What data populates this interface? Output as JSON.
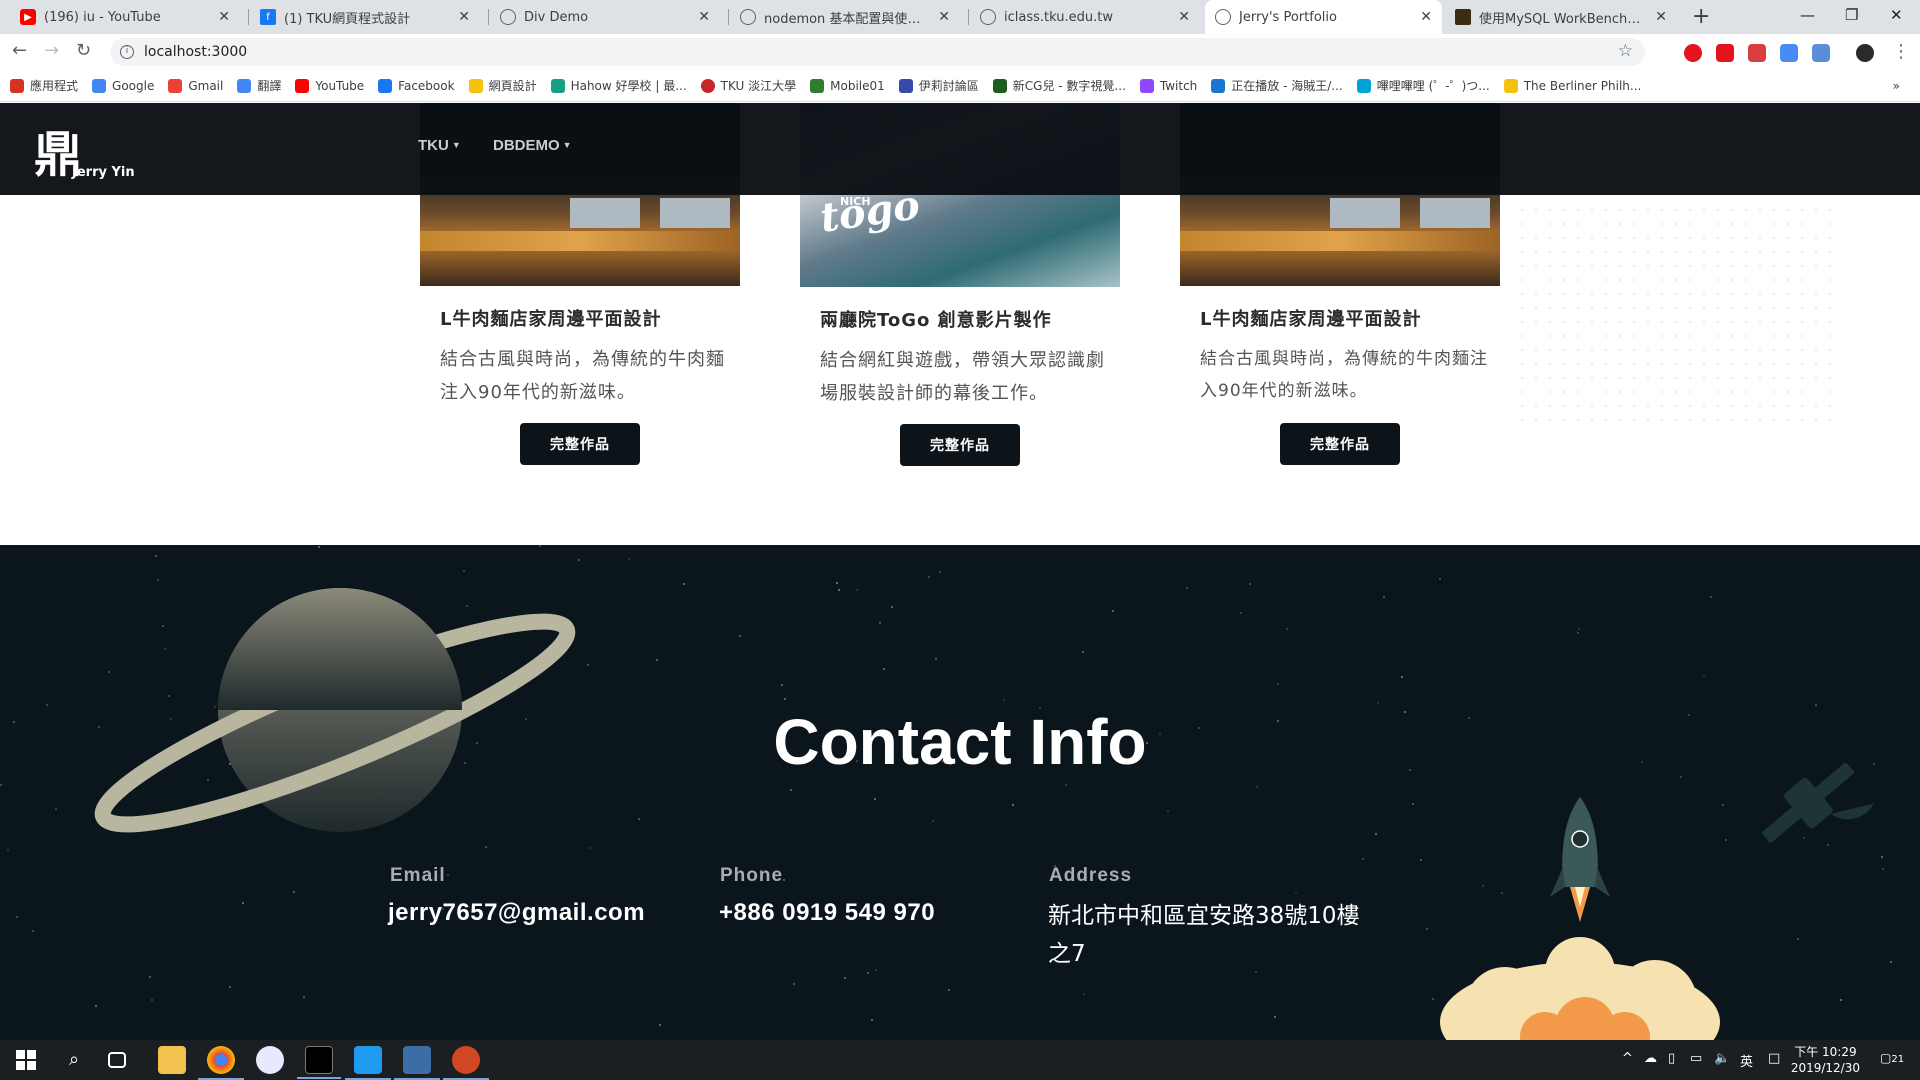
{
  "browser": {
    "tabs": [
      {
        "title": "(196) iu - YouTube",
        "favicon": "youtube-icon",
        "color": "#ff0000"
      },
      {
        "title": "(1) TKU網頁程式設計",
        "favicon": "facebook-icon",
        "color": "#1877f2"
      },
      {
        "title": "Div Demo",
        "favicon": "globe-icon",
        "color": "#5f6368"
      },
      {
        "title": "nodemon 基本配置與使用 - 壹言",
        "favicon": "globe-icon",
        "color": "#5f6368"
      },
      {
        "title": "iclass.tku.edu.tw",
        "favicon": "globe-icon",
        "color": "#5f6368"
      },
      {
        "title": "Jerry's Portfolio",
        "favicon": "globe-icon",
        "color": "#5f6368"
      },
      {
        "title": "使用MySQL WorkBench匯入資料",
        "favicon": "site-icon",
        "color": "#3b2d14"
      }
    ],
    "url": "localhost:3000",
    "bookmarks": [
      {
        "label": "應用程式",
        "color": "#d93025"
      },
      {
        "label": "Google",
        "color": "#4285f4"
      },
      {
        "label": "Gmail",
        "color": "#ea4335"
      },
      {
        "label": "翻譯",
        "color": "#4285f4"
      },
      {
        "label": "YouTube",
        "color": "#ff0000"
      },
      {
        "label": "Facebook",
        "color": "#1877f2"
      },
      {
        "label": "網頁設計",
        "color": "#f4c20d"
      },
      {
        "label": "Hahow 好學校 | 最...",
        "color": "#14a085"
      },
      {
        "label": "TKU 淡江大學",
        "color": "#c62828"
      },
      {
        "label": "Mobile01",
        "color": "#2e7d32"
      },
      {
        "label": "伊莉討論區",
        "color": "#3949ab"
      },
      {
        "label": "新CG兒 - 數字視覺...",
        "color": "#1b5e20"
      },
      {
        "label": "Twitch",
        "color": "#9146ff"
      },
      {
        "label": "正在播放 - 海賊王/...",
        "color": "#1976d2"
      },
      {
        "label": "嗶哩嗶哩 (゜-゜)つ...",
        "color": "#00a1d6"
      },
      {
        "label": "The Berliner Philh...",
        "color": "#f4c20d"
      }
    ]
  },
  "site": {
    "logo_name": "Jerry Yin",
    "logo_mark": "鼎",
    "nav": [
      {
        "label": "TKU"
      },
      {
        "label": "DBDEMO"
      }
    ]
  },
  "cards": [
    {
      "title": "L牛肉麵店家周邊平面設計",
      "desc": "結合古風與時尚，為傳統的牛肉麵注入90年代的新滋味。",
      "button": "完整作品"
    },
    {
      "title": "兩廳院ToGo 創意影片製作",
      "desc": "結合網紅與遊戲，帶領大眾認識劇場服裝設計師的幕後工作。",
      "button": "完整作品",
      "image_text": "togo",
      "image_text_small": "NICH"
    },
    {
      "title": "L牛肉麵店家周邊平面設計",
      "desc": "結合古風與時尚，為傳統的牛肉麵注入90年代的新滋味。",
      "button": "完整作品"
    }
  ],
  "contact": {
    "title": "Contact Info",
    "email_label": "Email",
    "email": "jerry7657@gmail.com",
    "phone_label": "Phone",
    "phone": "+886 0919 549 970",
    "address_label": "Address",
    "address": "新北市中和區宜安路38號10樓之7"
  },
  "taskbar": {
    "clock_time": "下午 10:29",
    "clock_date": "2019/12/30",
    "ime": "英",
    "notifications": "21"
  }
}
